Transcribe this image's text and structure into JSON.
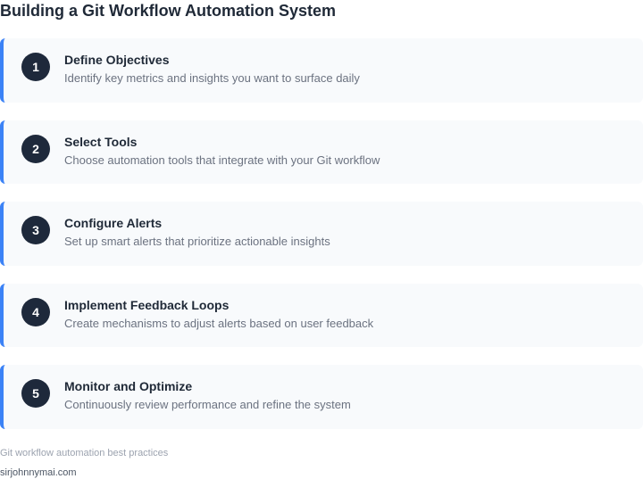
{
  "page": {
    "title": "Building a Git Workflow Automation System"
  },
  "steps": [
    {
      "number": "1",
      "title": "Define Objectives",
      "description": "Identify key metrics and insights you want to surface daily"
    },
    {
      "number": "2",
      "title": "Select Tools",
      "description": "Choose automation tools that integrate with your Git workflow"
    },
    {
      "number": "3",
      "title": "Configure Alerts",
      "description": "Set up smart alerts that prioritize actionable insights"
    },
    {
      "number": "4",
      "title": "Implement Feedback Loops",
      "description": "Create mechanisms to adjust alerts based on user feedback"
    },
    {
      "number": "5",
      "title": "Monitor and Optimize",
      "description": "Continuously review performance and refine the system"
    }
  ],
  "footer": {
    "caption": "Git workflow automation best practices",
    "source": "sirjohnnymai.com"
  },
  "colors": {
    "accent": "#3b82f6",
    "badge": "#1e293b",
    "card_background": "#f8fafc"
  }
}
